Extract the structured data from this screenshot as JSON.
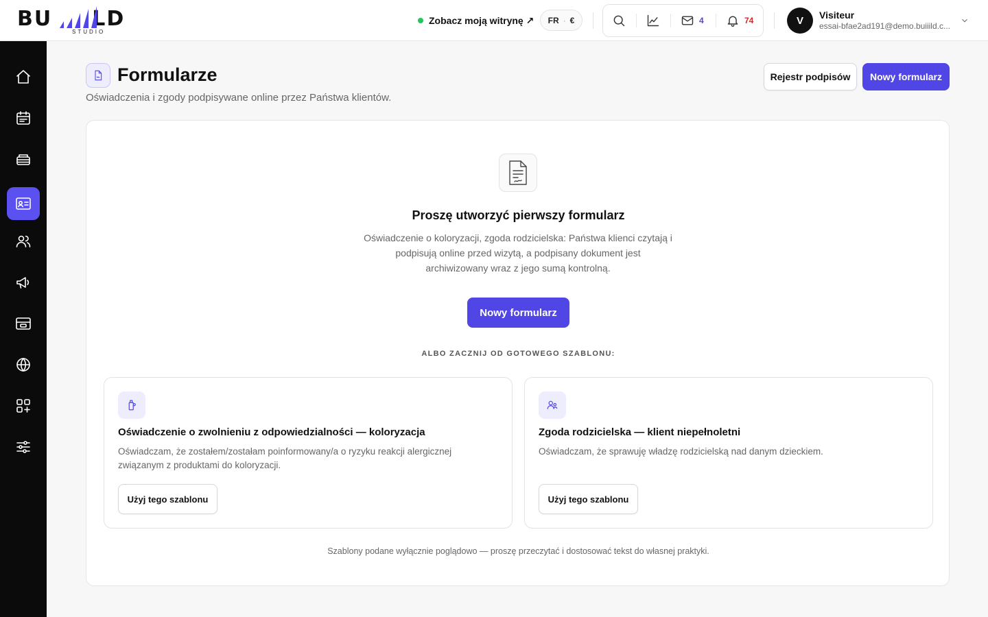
{
  "brand": {
    "logo_letters_left": "BU",
    "logo_letters_right": "LD",
    "logo_sub": "STUDIO"
  },
  "header": {
    "site_link": "Zobacz moją witrynę ↗",
    "language": "FR",
    "currency": "€",
    "messages_count": "4",
    "notifications_count": "74",
    "user": {
      "initial": "V",
      "name": "Visiteur",
      "email": "essai-bfae2ad191@demo.buiiild.c..."
    }
  },
  "sidebar": {
    "items": [
      {
        "name": "home",
        "icon": "home-icon"
      },
      {
        "name": "calendar",
        "icon": "calendar-icon"
      },
      {
        "name": "services",
        "icon": "stack-icon"
      },
      {
        "name": "forms",
        "icon": "id-card-icon",
        "active": true
      },
      {
        "name": "clients",
        "icon": "users-icon"
      },
      {
        "name": "marketing",
        "icon": "megaphone-icon"
      },
      {
        "name": "payments",
        "icon": "payment-icon"
      },
      {
        "name": "website",
        "icon": "globe-icon"
      },
      {
        "name": "apps",
        "icon": "apps-icon"
      },
      {
        "name": "settings",
        "icon": "sliders-icon"
      }
    ]
  },
  "page": {
    "title": "Formularze",
    "subtitle": "Oświadczenia i zgody podpisywane online przez Państwa klientów.",
    "register_button": "Rejestr podpisów",
    "new_button": "Nowy formularz"
  },
  "empty_state": {
    "title": "Proszę utworzyć pierwszy formularz",
    "description": "Oświadczenie o koloryzacji, zgoda rodzicielska: Państwa klienci czytają i podpisują online przed wizytą, a podpisany dokument jest archiwizowany wraz z jego sumą kontrolną.",
    "button": "Nowy formularz",
    "templates_label": "ALBO ZACZNIJ OD GOTOWEGO SZABLONU:"
  },
  "templates": [
    {
      "icon": "color-bottle-icon",
      "title": "Oświadczenie o zwolnieniu z odpowiedzialności — koloryzacja",
      "description": "Oświadczam, że zostałem/zostałam poinformowany/a o ryzyku reakcji alergicznej związanym z produktami do koloryzacji.",
      "button": "Użyj tego szablonu"
    },
    {
      "icon": "parent-child-icon",
      "title": "Zgoda rodzicielska — klient niepełnoletni",
      "description": "Oświadczam, że sprawuję władzę rodzicielską nad danym dzieckiem.",
      "button": "Użyj tego szablonu"
    }
  ],
  "disclaimer": "Szablony podane wyłącznie poglądowo — proszę przeczytać i dostosować tekst do własnej praktyki.",
  "colors": {
    "accent": "#4f46e5",
    "sidebar_active": "#5b50f0",
    "sidebar_bg": "#0b0b0c",
    "status_online": "#22c55e",
    "notification": "#dc2626"
  }
}
